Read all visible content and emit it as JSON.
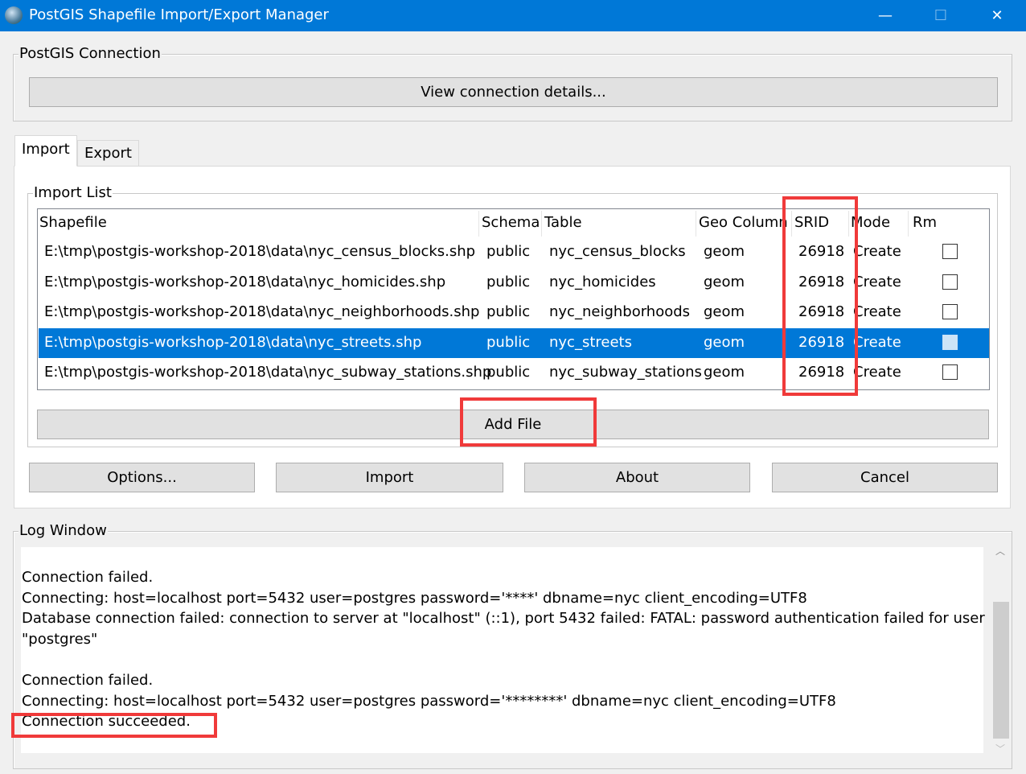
{
  "window": {
    "title": "PostGIS Shapefile Import/Export Manager",
    "minimize": "—",
    "maximize": "☐",
    "close": "✕"
  },
  "connection": {
    "group_label": "PostGIS Connection",
    "view_button": "View connection details..."
  },
  "tabs": [
    {
      "label": "Import"
    },
    {
      "label": "Export"
    }
  ],
  "import_list": {
    "group_label": "Import List",
    "columns": [
      "Shapefile",
      "Schema",
      "Table",
      "Geo Column",
      "SRID",
      "Mode",
      "Rm"
    ],
    "rows": [
      {
        "shapefile": "E:\\tmp\\postgis-workshop-2018\\data\\nyc_census_blocks.shp",
        "schema": "public",
        "table": "nyc_census_blocks",
        "geo": "geom",
        "srid": "26918",
        "mode": "Create",
        "rm": false
      },
      {
        "shapefile": "E:\\tmp\\postgis-workshop-2018\\data\\nyc_homicides.shp",
        "schema": "public",
        "table": "nyc_homicides",
        "geo": "geom",
        "srid": "26918",
        "mode": "Create",
        "rm": false
      },
      {
        "shapefile": "E:\\tmp\\postgis-workshop-2018\\data\\nyc_neighborhoods.shp",
        "schema": "public",
        "table": "nyc_neighborhoods",
        "geo": "geom",
        "srid": "26918",
        "mode": "Create",
        "rm": false
      },
      {
        "shapefile": "E:\\tmp\\postgis-workshop-2018\\data\\nyc_streets.shp",
        "schema": "public",
        "table": "nyc_streets",
        "geo": "geom",
        "srid": "26918",
        "mode": "Create",
        "rm": false,
        "selected": true
      },
      {
        "shapefile": "E:\\tmp\\postgis-workshop-2018\\data\\nyc_subway_stations.shp",
        "schema": "public",
        "table": "nyc_subway_stations",
        "geo": "geom",
        "srid": "26918",
        "mode": "Create",
        "rm": false
      }
    ],
    "add_file": "Add File"
  },
  "buttons": {
    "options": "Options...",
    "import": "Import",
    "about": "About",
    "cancel": "Cancel"
  },
  "log": {
    "group_label": "Log Window",
    "lines": [
      "Connection failed.",
      "Connecting:  host=localhost port=5432 user=postgres password='****' dbname=nyc client_encoding=UTF8",
      "Database connection failed: connection to server at \"localhost\" (::1), port 5432 failed: FATAL:  password authentication failed for user",
      "\"postgres\"",
      "",
      "Connection failed.",
      "Connecting:  host=localhost port=5432 user=postgres password='********' dbname=nyc client_encoding=UTF8",
      "Connection succeeded."
    ]
  },
  "colors": {
    "titlebar": "#0078d7",
    "selection": "#0078d7",
    "highlight": "#f03a3a"
  }
}
